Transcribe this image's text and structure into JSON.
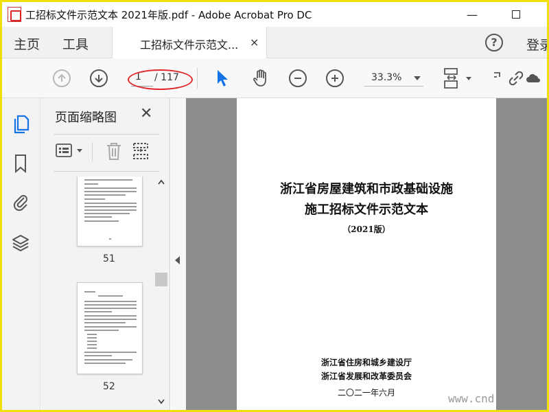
{
  "window": {
    "title": "工招标文件示范文本 2021年版.pdf - Adobe Acrobat Pro DC",
    "min_glyph": "—"
  },
  "menubar": {
    "home": "主页",
    "tools": "工具",
    "tab_label": "工招标文件示范文...",
    "tab_close": "×",
    "help": "?",
    "signin": "登录"
  },
  "toolbar": {
    "current_page": "1",
    "total_pages": "/ 117",
    "zoom": "33.3%"
  },
  "thumbnails": {
    "title": "页面缩略图",
    "close": "✕",
    "pages": [
      {
        "label": "51"
      },
      {
        "label": "52"
      }
    ]
  },
  "document": {
    "title_line1": "浙江省房屋建筑和市政基础设施",
    "title_line2": "施工招标文件示范文本",
    "edition": "（2021版）",
    "issuer1": "浙江省住房和城乡建设厅",
    "issuer2": "浙江省发展和改革委员会",
    "date": "二〇二一年六月"
  },
  "watermark": "www.cnd",
  "colors": {
    "frame": "#f0e000",
    "highlight_oval": "#e0282a",
    "select_tool": "#1473e6",
    "doc_background": "#8c8c8c"
  },
  "icons": [
    "app-icon",
    "help-icon",
    "up-arrow-icon",
    "down-arrow-icon",
    "select-cursor-icon",
    "hand-icon",
    "zoom-out-icon",
    "zoom-in-icon",
    "page-fit-icon",
    "share-link-icon",
    "pages-icon",
    "bookmark-icon",
    "attachment-icon",
    "layers-icon",
    "options-menu-icon",
    "trash-icon",
    "insert-page-icon"
  ]
}
